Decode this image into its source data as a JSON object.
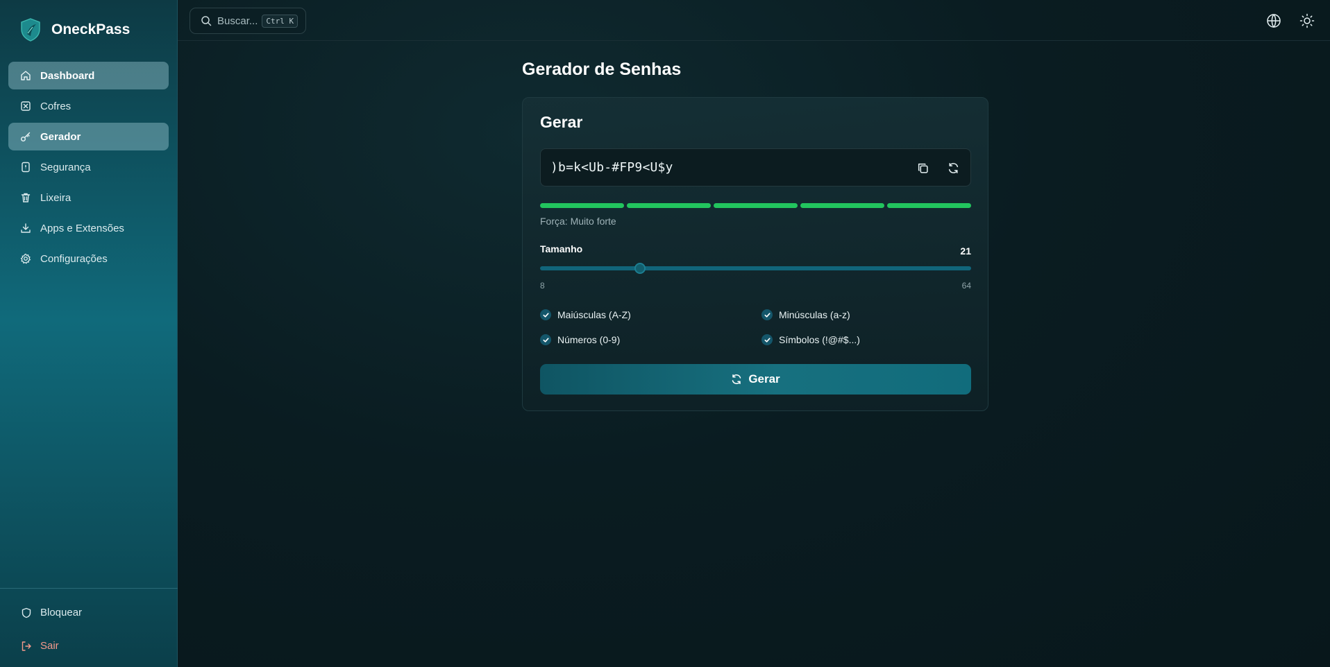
{
  "app": {
    "name": "OneckPass"
  },
  "sidebar": {
    "items": [
      {
        "label": "Dashboard",
        "icon": "home-icon"
      },
      {
        "label": "Cofres",
        "icon": "vault-icon"
      },
      {
        "label": "Gerador",
        "icon": "key-icon"
      },
      {
        "label": "Segurança",
        "icon": "security-icon"
      },
      {
        "label": "Lixeira",
        "icon": "trash-icon"
      },
      {
        "label": "Apps e Extensões",
        "icon": "download-icon"
      },
      {
        "label": "Configurações",
        "icon": "settings-icon"
      }
    ],
    "active_items": [
      "Dashboard",
      "Gerador"
    ],
    "lock_label": "Bloquear",
    "logout_label": "Sair"
  },
  "search": {
    "placeholder": "Buscar...",
    "shortcut": "Ctrl K"
  },
  "topbar": {
    "icons": [
      "globe-icon",
      "sun-icon"
    ]
  },
  "page": {
    "title": "Gerador de Senhas"
  },
  "generator": {
    "card_title": "Gerar",
    "password": ")b=k<Ub-#FP9<U$y",
    "strength_segments_filled": 5,
    "strength_segments_total": 5,
    "strength_label": "Força: Muito forte",
    "size_label": "Tamanho",
    "size_value": "21",
    "size_min": "8",
    "size_max": "64",
    "options": {
      "uppercase": {
        "label": "Maiúsculas (A-Z)",
        "checked": true
      },
      "lowercase": {
        "label": "Minúsculas (a-z)",
        "checked": true
      },
      "numbers": {
        "label": "Números (0-9)",
        "checked": true
      },
      "symbols": {
        "label": "Símbolos (!@#$...)",
        "checked": true
      }
    },
    "generate_button": "Gerar"
  },
  "colors": {
    "accent": "#106a7b",
    "strength": "#22c55e",
    "logout": "#f59a8c",
    "background": "#0a1c21"
  }
}
